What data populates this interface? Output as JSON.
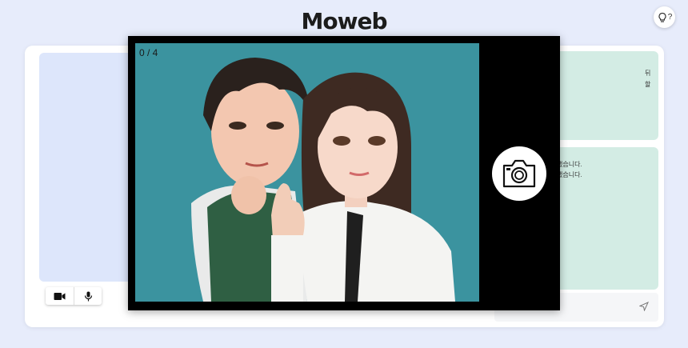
{
  "header": {
    "logo": "Moweb",
    "hint_label": "?"
  },
  "side": {
    "top_lines": [
      "뒤",
      "할"
    ],
    "bottom_lines": [
      "했습니다.",
      "했습니다."
    ]
  },
  "modal": {
    "counter": "0 / 4"
  },
  "icons": {
    "hint": "lightbulb-icon",
    "video": "video-camera-icon",
    "mic": "microphone-icon",
    "send": "send-icon",
    "capture": "camera-icon"
  },
  "colors": {
    "background": "#e7ecfb",
    "stage": "#3b939f",
    "side_card": "#d3ece4",
    "video_area": "#dde6fb"
  }
}
